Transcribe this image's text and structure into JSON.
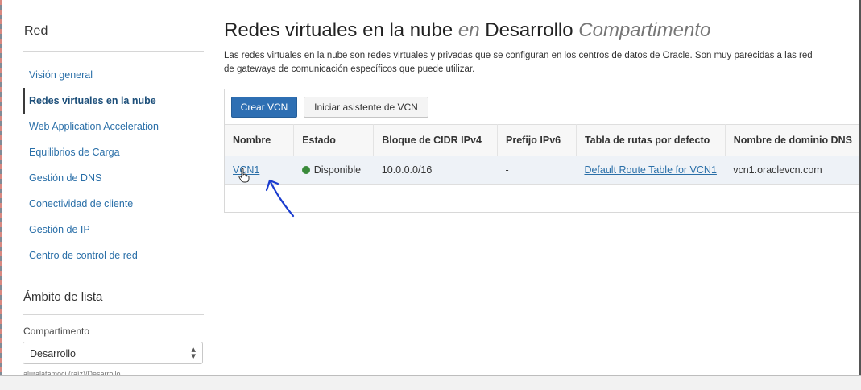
{
  "sidebar": {
    "title": "Red",
    "items": [
      {
        "label": "Visión general"
      },
      {
        "label": "Redes virtuales en la nube"
      },
      {
        "label": "Web Application Acceleration"
      },
      {
        "label": "Equilibrios de Carga"
      },
      {
        "label": "Gestión de DNS"
      },
      {
        "label": "Conectividad de cliente"
      },
      {
        "label": "Gestión de IP"
      },
      {
        "label": "Centro de control de red"
      }
    ],
    "active_item": "Redes virtuales en la nube",
    "scope_title": "Ámbito de lista",
    "compartment_label": "Compartimento",
    "compartment_value": "Desarrollo",
    "compartment_path": "aluralatamoci (raíz)/Desarrollo"
  },
  "header": {
    "title_main": "Redes virtuales en la nube",
    "title_en": "en",
    "title_compartment": "Desarrollo",
    "title_suffix": "Compartimento",
    "description_line1": "Las redes virtuales en la nube son redes virtuales y privadas que se configuran en los centros de datos de Oracle. Son muy parecidas a las red",
    "description_line2": "de gateways de comunicación específicos que puede utilizar."
  },
  "toolbar": {
    "create_label": "Crear VCN",
    "wizard_label": "Iniciar asistente de VCN"
  },
  "table": {
    "columns": [
      "Nombre",
      "Estado",
      "Bloque de CIDR IPv4",
      "Prefijo IPv6",
      "Tabla de rutas por defecto",
      "Nombre de dominio DNS"
    ],
    "rows": [
      {
        "name": "VCN1",
        "status": "Disponible",
        "cidr": "10.0.0.0/16",
        "ipv6": "-",
        "route_table": "Default Route Table for VCN1",
        "dns": "vcn1.oraclevcn.com"
      }
    ]
  },
  "colors": {
    "primary": "#2e6fb3",
    "link": "#2a6fa8",
    "status_available": "#3a8a3a",
    "annotation": "#1a3ccf"
  }
}
